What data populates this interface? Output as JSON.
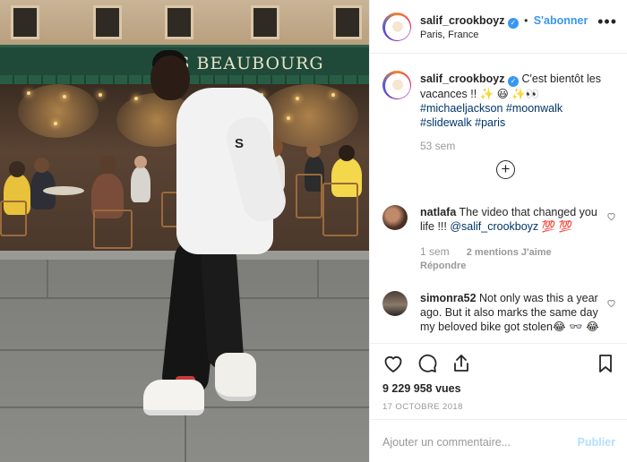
{
  "post": {
    "username": "salif_crookboyz",
    "verified_glyph": "✓",
    "separator": "•",
    "follow_label": "S'abonner",
    "location": "Paris, France",
    "more_label": "•••"
  },
  "media": {
    "storefront_sign": "IS BEAUBOURG",
    "hoodie_logo": "S"
  },
  "caption": {
    "username": "salif_crookboyz",
    "text": "C'est bientôt les vacances !! ✨ 😃 ✨👀",
    "hashtags": [
      "#michaeljackson",
      "#moonwalk",
      "#slidewalk",
      "#paris"
    ],
    "time": "53 sem",
    "load_more_glyph": "+"
  },
  "comments": [
    {
      "username": "natlafa",
      "text_before": "The video that changed you life !!! ",
      "mention": "@salif_crookboyz",
      "text_after": " 💯 💯",
      "time": "1 sem",
      "likes": "2 mentions J'aime",
      "reply": "Répondre"
    },
    {
      "username": "simonra52",
      "text": "Not only was this a year ago. But it also marks the same day my beloved bike got stolen😂 👓 😂"
    }
  ],
  "stats": {
    "views": "9 229 958 vues",
    "date": "17 OCTOBRE 2018"
  },
  "composer": {
    "placeholder": "Ajouter un commentaire...",
    "publish_label": "Publier"
  },
  "colors": {
    "link_blue": "#3897f0",
    "hashtag": "#003569",
    "muted": "#999999"
  },
  "icons": [
    "heart-icon",
    "comment-icon",
    "share-icon",
    "bookmark-icon",
    "small-heart-icon",
    "add-circle-icon",
    "verified-icon",
    "more-icon"
  ]
}
